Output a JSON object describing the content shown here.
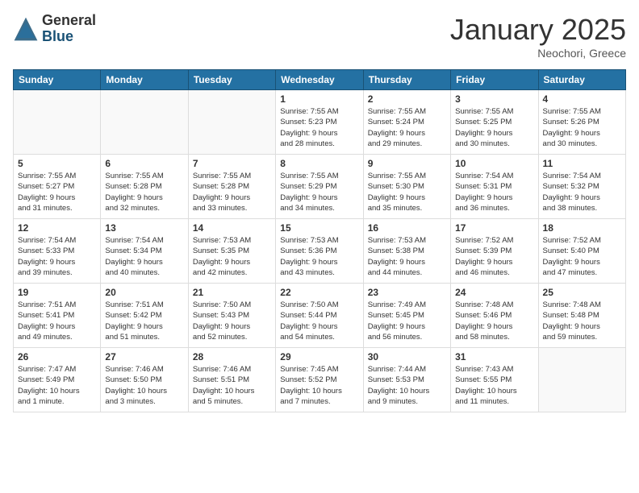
{
  "header": {
    "logo_general": "General",
    "logo_blue": "Blue",
    "month_title": "January 2025",
    "location": "Neochori, Greece"
  },
  "weekdays": [
    "Sunday",
    "Monday",
    "Tuesday",
    "Wednesday",
    "Thursday",
    "Friday",
    "Saturday"
  ],
  "weeks": [
    [
      {
        "day": "",
        "info": ""
      },
      {
        "day": "",
        "info": ""
      },
      {
        "day": "",
        "info": ""
      },
      {
        "day": "1",
        "info": "Sunrise: 7:55 AM\nSunset: 5:23 PM\nDaylight: 9 hours\nand 28 minutes."
      },
      {
        "day": "2",
        "info": "Sunrise: 7:55 AM\nSunset: 5:24 PM\nDaylight: 9 hours\nand 29 minutes."
      },
      {
        "day": "3",
        "info": "Sunrise: 7:55 AM\nSunset: 5:25 PM\nDaylight: 9 hours\nand 30 minutes."
      },
      {
        "day": "4",
        "info": "Sunrise: 7:55 AM\nSunset: 5:26 PM\nDaylight: 9 hours\nand 30 minutes."
      }
    ],
    [
      {
        "day": "5",
        "info": "Sunrise: 7:55 AM\nSunset: 5:27 PM\nDaylight: 9 hours\nand 31 minutes."
      },
      {
        "day": "6",
        "info": "Sunrise: 7:55 AM\nSunset: 5:28 PM\nDaylight: 9 hours\nand 32 minutes."
      },
      {
        "day": "7",
        "info": "Sunrise: 7:55 AM\nSunset: 5:28 PM\nDaylight: 9 hours\nand 33 minutes."
      },
      {
        "day": "8",
        "info": "Sunrise: 7:55 AM\nSunset: 5:29 PM\nDaylight: 9 hours\nand 34 minutes."
      },
      {
        "day": "9",
        "info": "Sunrise: 7:55 AM\nSunset: 5:30 PM\nDaylight: 9 hours\nand 35 minutes."
      },
      {
        "day": "10",
        "info": "Sunrise: 7:54 AM\nSunset: 5:31 PM\nDaylight: 9 hours\nand 36 minutes."
      },
      {
        "day": "11",
        "info": "Sunrise: 7:54 AM\nSunset: 5:32 PM\nDaylight: 9 hours\nand 38 minutes."
      }
    ],
    [
      {
        "day": "12",
        "info": "Sunrise: 7:54 AM\nSunset: 5:33 PM\nDaylight: 9 hours\nand 39 minutes."
      },
      {
        "day": "13",
        "info": "Sunrise: 7:54 AM\nSunset: 5:34 PM\nDaylight: 9 hours\nand 40 minutes."
      },
      {
        "day": "14",
        "info": "Sunrise: 7:53 AM\nSunset: 5:35 PM\nDaylight: 9 hours\nand 42 minutes."
      },
      {
        "day": "15",
        "info": "Sunrise: 7:53 AM\nSunset: 5:36 PM\nDaylight: 9 hours\nand 43 minutes."
      },
      {
        "day": "16",
        "info": "Sunrise: 7:53 AM\nSunset: 5:38 PM\nDaylight: 9 hours\nand 44 minutes."
      },
      {
        "day": "17",
        "info": "Sunrise: 7:52 AM\nSunset: 5:39 PM\nDaylight: 9 hours\nand 46 minutes."
      },
      {
        "day": "18",
        "info": "Sunrise: 7:52 AM\nSunset: 5:40 PM\nDaylight: 9 hours\nand 47 minutes."
      }
    ],
    [
      {
        "day": "19",
        "info": "Sunrise: 7:51 AM\nSunset: 5:41 PM\nDaylight: 9 hours\nand 49 minutes."
      },
      {
        "day": "20",
        "info": "Sunrise: 7:51 AM\nSunset: 5:42 PM\nDaylight: 9 hours\nand 51 minutes."
      },
      {
        "day": "21",
        "info": "Sunrise: 7:50 AM\nSunset: 5:43 PM\nDaylight: 9 hours\nand 52 minutes."
      },
      {
        "day": "22",
        "info": "Sunrise: 7:50 AM\nSunset: 5:44 PM\nDaylight: 9 hours\nand 54 minutes."
      },
      {
        "day": "23",
        "info": "Sunrise: 7:49 AM\nSunset: 5:45 PM\nDaylight: 9 hours\nand 56 minutes."
      },
      {
        "day": "24",
        "info": "Sunrise: 7:48 AM\nSunset: 5:46 PM\nDaylight: 9 hours\nand 58 minutes."
      },
      {
        "day": "25",
        "info": "Sunrise: 7:48 AM\nSunset: 5:48 PM\nDaylight: 9 hours\nand 59 minutes."
      }
    ],
    [
      {
        "day": "26",
        "info": "Sunrise: 7:47 AM\nSunset: 5:49 PM\nDaylight: 10 hours\nand 1 minute."
      },
      {
        "day": "27",
        "info": "Sunrise: 7:46 AM\nSunset: 5:50 PM\nDaylight: 10 hours\nand 3 minutes."
      },
      {
        "day": "28",
        "info": "Sunrise: 7:46 AM\nSunset: 5:51 PM\nDaylight: 10 hours\nand 5 minutes."
      },
      {
        "day": "29",
        "info": "Sunrise: 7:45 AM\nSunset: 5:52 PM\nDaylight: 10 hours\nand 7 minutes."
      },
      {
        "day": "30",
        "info": "Sunrise: 7:44 AM\nSunset: 5:53 PM\nDaylight: 10 hours\nand 9 minutes."
      },
      {
        "day": "31",
        "info": "Sunrise: 7:43 AM\nSunset: 5:55 PM\nDaylight: 10 hours\nand 11 minutes."
      },
      {
        "day": "",
        "info": ""
      }
    ]
  ]
}
